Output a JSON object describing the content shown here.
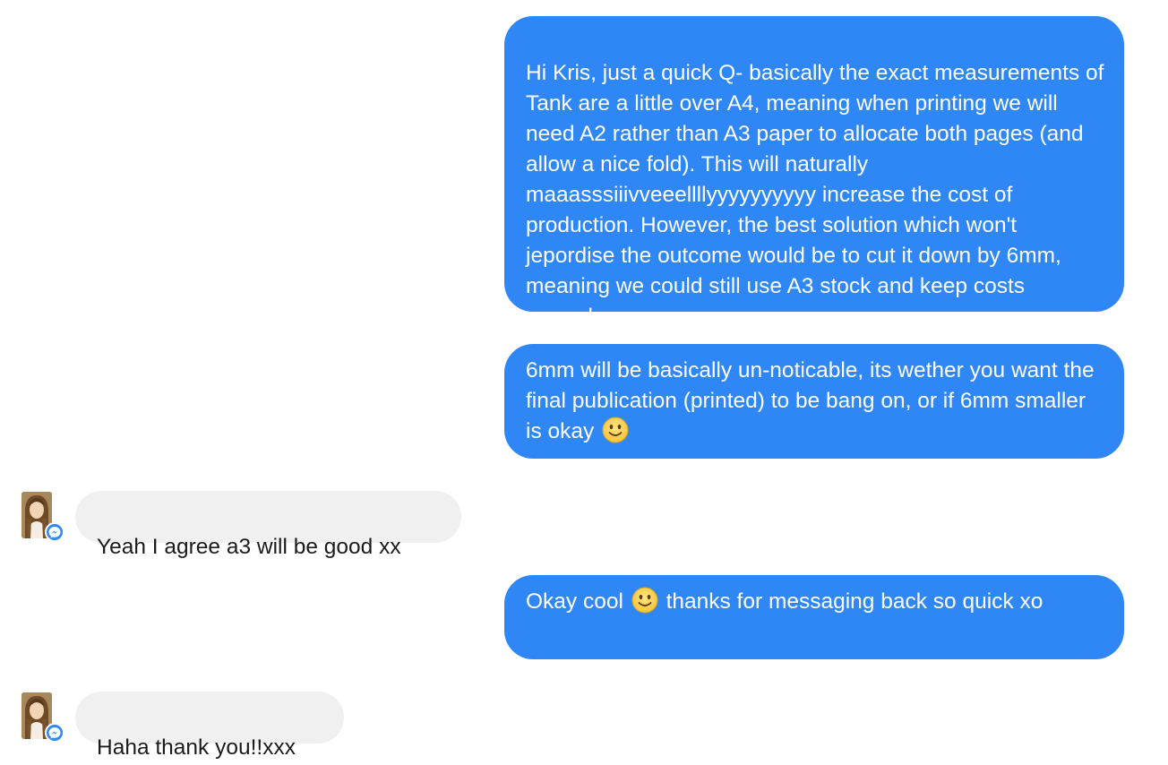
{
  "colors": {
    "outgoing_bubble": "#2f87f6",
    "incoming_bubble": "#f0f0f0",
    "outgoing_text": "#ffffff",
    "incoming_text": "#1b1b1b"
  },
  "messages": [
    {
      "direction": "outgoing",
      "text": "Hi Kris, just a quick Q- basically the exact measurements of Tank are a little over A4, meaning when printing we will need A2 rather than A3 paper to allocate both pages (and allow a nice fold). This will naturally maaasssiiivveeellllyyyyyyyyyy increase the cost of production. However, the best solution which won't jepordise the outcome would be to cut it down by 6mm, meaning we could still use A3 stock and keep costs normal.. xxx"
    },
    {
      "direction": "outgoing",
      "text_before_emoji": "6mm will be basically un-noticable, its wether you want the final publication (printed) to be bang on, or if 6mm smaller is okay",
      "emoji": "slightly-smiling-face-icon"
    },
    {
      "direction": "incoming",
      "text": "Yeah I agree a3 will be good xx",
      "avatar": "avatar-icon",
      "badge": "messenger-badge-icon"
    },
    {
      "direction": "outgoing",
      "text_before_emoji": "Okay cool",
      "emoji": "slightly-smiling-face-icon",
      "text_after_emoji": "thanks for messaging back so quick xo"
    },
    {
      "direction": "incoming",
      "text": "Haha thank you!!xxx",
      "avatar": "avatar-icon",
      "badge": "messenger-badge-icon"
    }
  ]
}
